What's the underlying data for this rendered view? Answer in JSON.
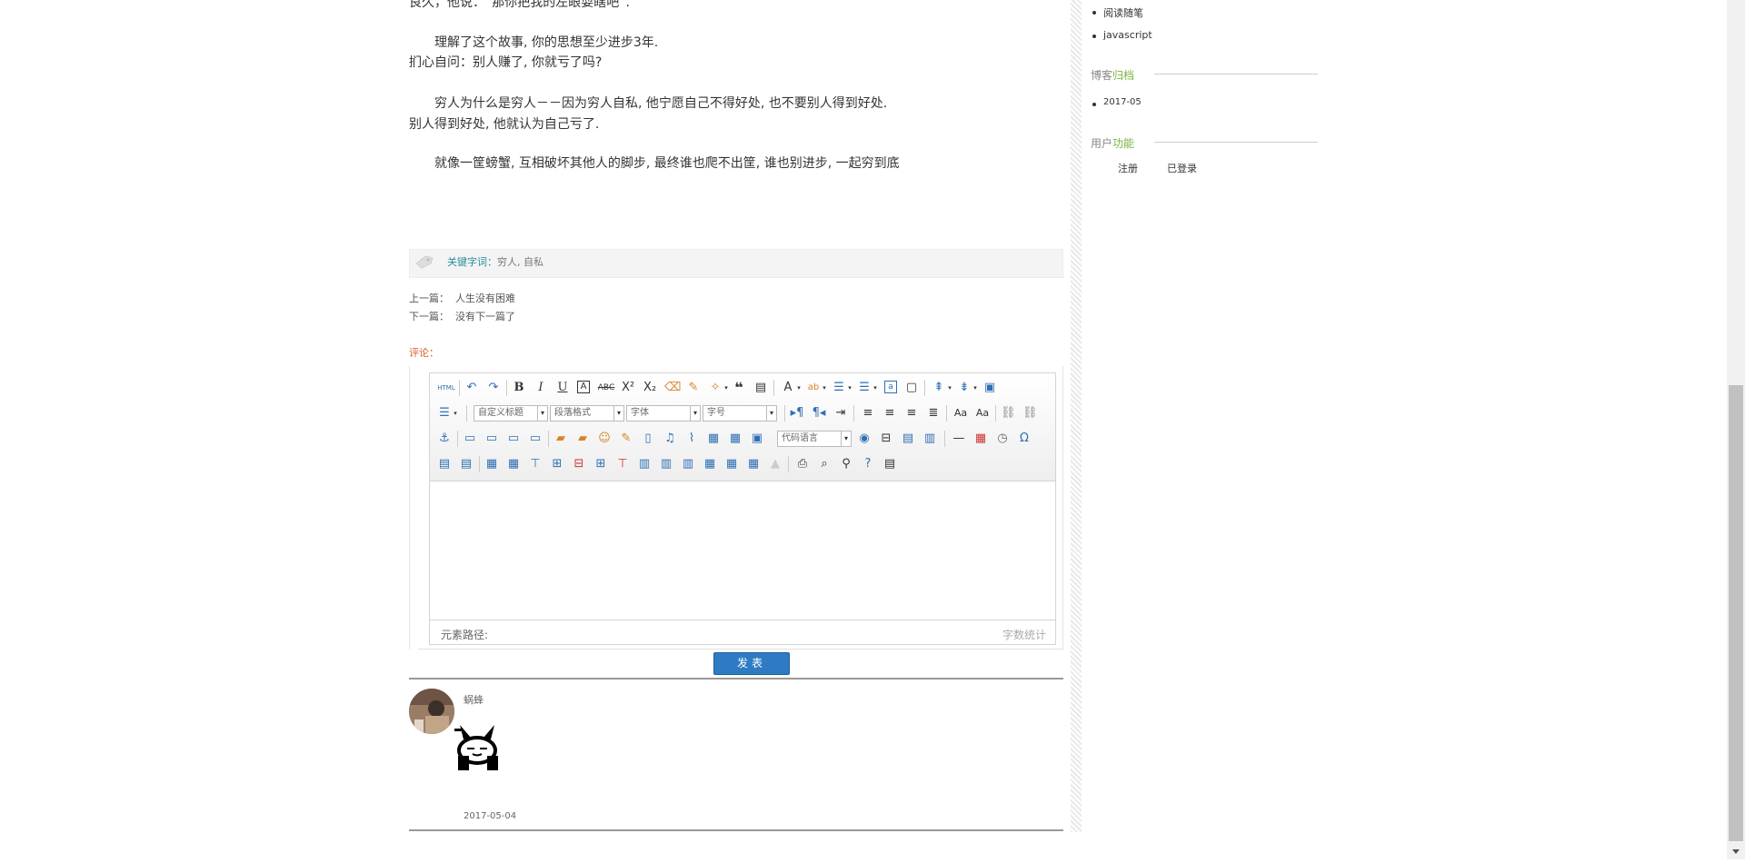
{
  "article": {
    "line0_prefix": "良久，他说：",
    "line0_quote": "“那你把我的左眼耍瞎吧”.",
    "line1": "理解了这个故事, 你的思想至少进步3年.",
    "line2": "扪心自问：别人赚了, 你就亏了吗?",
    "line3": "穷人为什么是穷人－－因为穷人自私, 他宁愿自己不得好处, 也不要别人得到好处.",
    "line4": "别人得到好处, 他就认为自己亏了.",
    "line5": "就像一筐螃蟹, 互相破坏其他人的脚步, 最终谁也爬不出筐, 谁也别进步, 一起穷到底"
  },
  "keywords": {
    "label": "关键字词：",
    "value": "穷人, 自私"
  },
  "nav": {
    "prev_label": "上一篇：",
    "prev_title": "人生没有困难",
    "next_label": "下一篇：",
    "next_title": "没有下一篇了"
  },
  "comments": {
    "heading": "评论："
  },
  "editor": {
    "combos": {
      "custom_title": "自定义标题",
      "paragraph": "段落格式",
      "font": "字体",
      "size": "字号",
      "code_lang": "代码语言"
    },
    "status_path": "元素路径:",
    "status_count": "字数统计",
    "submit": "发表"
  },
  "comment": {
    "author": "蜗蜂",
    "date": "2017-05-04"
  },
  "sidebar": {
    "list_items": [
      "阅读随笔",
      "javascript"
    ],
    "archive_head": [
      "博客",
      "归档"
    ],
    "archive_items": [
      "2017-05"
    ],
    "user_head": [
      "用户",
      "功能"
    ],
    "user_links": [
      "注册",
      "已登录"
    ]
  },
  "colors": {
    "accent_red": "#e60012",
    "button_blue": "#2e7bc4",
    "side_green": "#7cb342"
  }
}
